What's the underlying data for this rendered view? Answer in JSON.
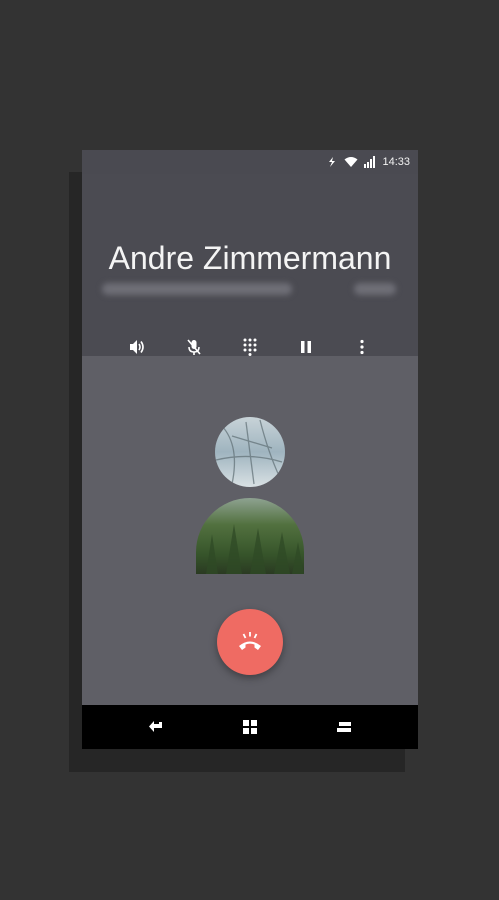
{
  "status_bar": {
    "time": "14:33",
    "icons": [
      "data-transfer-icon",
      "wifi-icon",
      "signal-icon"
    ]
  },
  "call": {
    "contact_name": "Andre Zimmermann",
    "controls": [
      "speaker-icon",
      "mute-microphone-icon",
      "dialpad-icon",
      "hold-icon",
      "more-options-icon"
    ],
    "end_call_icon": "end-call-icon",
    "accent_color": "#ef6b63"
  },
  "navigation": {
    "buttons": [
      "back-icon",
      "home-icon",
      "recent-apps-icon"
    ]
  }
}
